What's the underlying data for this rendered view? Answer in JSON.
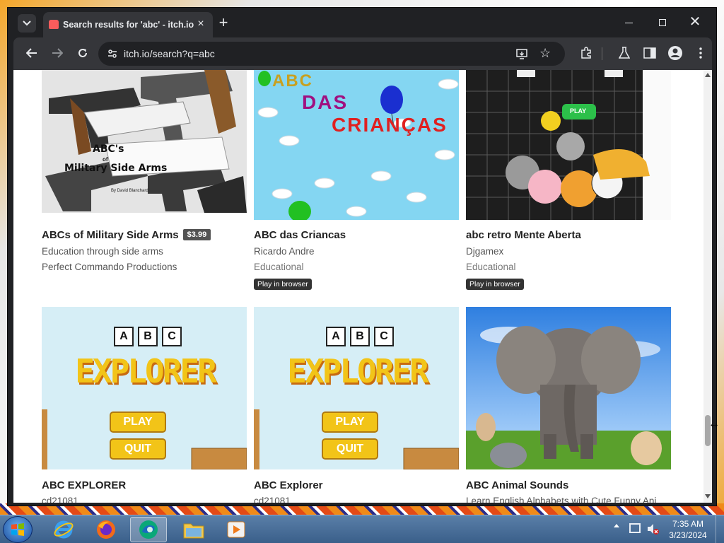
{
  "browser": {
    "tab_title": "Search results for 'abc' - itch.io",
    "url": "itch.io/search?q=abc"
  },
  "games": [
    {
      "title": "ABCs of Military Side Arms",
      "price": "$3.99",
      "line1": "Education through side arms",
      "line2": "Perfect Commando Productions",
      "thumb_text_1": "ABC's",
      "thumb_text_2": "of",
      "thumb_text_3": "Military Side Arms",
      "thumb_text_4": "By David Blanchard"
    },
    {
      "title": "ABC das Criancas",
      "line1": "Ricardo Andre",
      "line2": "Educational",
      "badge": "Play in browser",
      "thumb_text_1": "ABC",
      "thumb_text_2": "DAS",
      "thumb_text_3": "CRIANÇAS"
    },
    {
      "title": "abc retro Mente Aberta",
      "line1": "Djgamex",
      "line2": "Educational",
      "badge": "Play in browser",
      "thumb_text_1": "PLAY"
    },
    {
      "title": "ABC EXPLORER",
      "line1": "cd21081",
      "thumb_text_1": "EXPLORER",
      "thumb_text_2": "PLAY",
      "thumb_text_3": "QUIT"
    },
    {
      "title": "ABC Explorer",
      "line1": "cd21081",
      "thumb_text_1": "EXPLORER",
      "thumb_text_2": "PLAY",
      "thumb_text_3": "QUIT"
    },
    {
      "title": "ABC Animal Sounds",
      "line1": "Learn English Alphabets with Cute Funny Ani..."
    }
  ],
  "abc_boxes": [
    "A",
    "B",
    "C"
  ],
  "taskbar": {
    "time": "7:35 AM",
    "date": "3/23/2024"
  },
  "colors": {
    "itch_accent": "#fa5c5c",
    "chrome_dark": "#202124",
    "chrome_toolbar": "#35363a"
  }
}
